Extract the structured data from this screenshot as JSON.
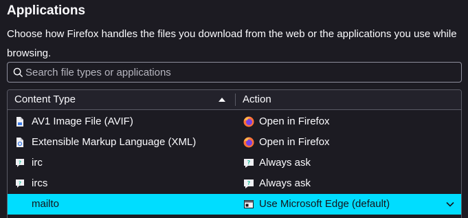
{
  "section": {
    "title": "Applications",
    "description": "Choose how Firefox handles the files you download from the web or the applications you use while browsing."
  },
  "search": {
    "placeholder": "Search file types or applications",
    "value": ""
  },
  "table": {
    "columns": {
      "content_type": "Content Type",
      "action": "Action",
      "sort": "ascending"
    },
    "rows": [
      {
        "content_type": "AV1 Image File (AVIF)",
        "type_icon": "document-icon",
        "action": "Open in Firefox",
        "action_icon": "firefox-icon"
      },
      {
        "content_type": "Extensible Markup Language (XML)",
        "type_icon": "xml-document-icon",
        "action": "Open in Firefox",
        "action_icon": "firefox-icon"
      },
      {
        "content_type": "irc",
        "type_icon": "chat-icon",
        "action": "Always ask",
        "action_icon": "ask-icon"
      },
      {
        "content_type": "ircs",
        "type_icon": "chat-icon",
        "action": "Always ask",
        "action_icon": "ask-icon"
      },
      {
        "content_type": "mailto",
        "type_icon": "",
        "action": "Use Microsoft Edge (default)",
        "action_icon": "app-window-icon",
        "selected": true
      }
    ]
  },
  "colors": {
    "background": "#1c1b22",
    "selection": "#00ddff",
    "border": "#5b5b66"
  }
}
